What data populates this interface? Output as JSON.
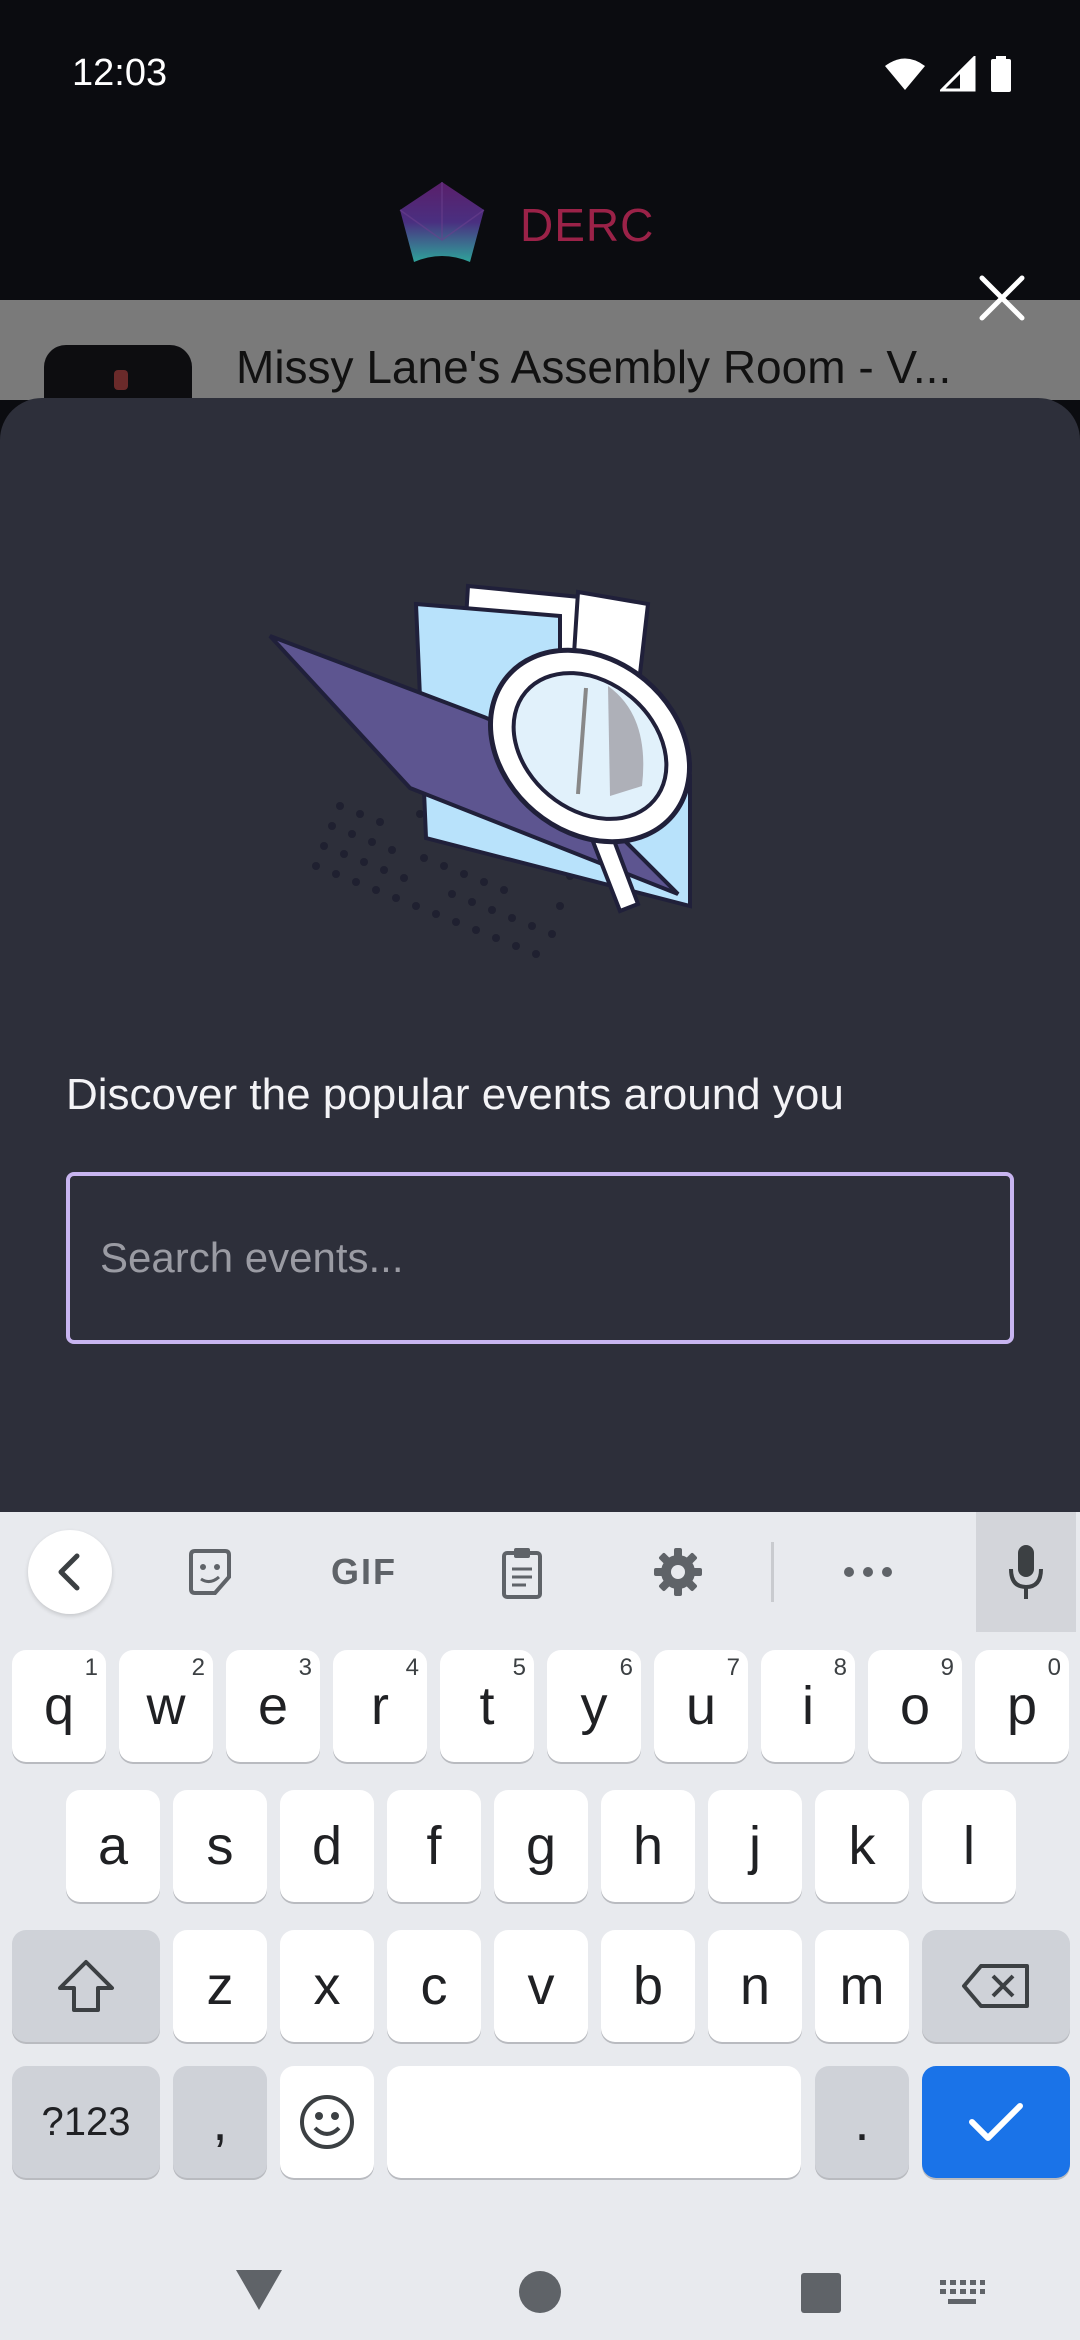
{
  "status_bar": {
    "time": "12:03"
  },
  "app": {
    "brand": "DERC"
  },
  "background": {
    "event_title": "Missy Lane's Assembly Room - V..."
  },
  "sheet": {
    "headline": "Discover the popular events around you",
    "search_placeholder": "Search events..."
  },
  "keyboard": {
    "toolbar": {
      "gif_label": "GIF",
      "icons": [
        "back-chevron-icon",
        "sticker-icon",
        "gif-icon",
        "clipboard-icon",
        "settings-gear-icon",
        "more-dots-icon",
        "microphone-icon"
      ]
    },
    "row1": [
      {
        "k": "q",
        "h": "1"
      },
      {
        "k": "w",
        "h": "2"
      },
      {
        "k": "e",
        "h": "3"
      },
      {
        "k": "r",
        "h": "4"
      },
      {
        "k": "t",
        "h": "5"
      },
      {
        "k": "y",
        "h": "6"
      },
      {
        "k": "u",
        "h": "7"
      },
      {
        "k": "i",
        "h": "8"
      },
      {
        "k": "o",
        "h": "9"
      },
      {
        "k": "p",
        "h": "0"
      }
    ],
    "row2": [
      "a",
      "s",
      "d",
      "f",
      "g",
      "h",
      "j",
      "k",
      "l"
    ],
    "row3": [
      "z",
      "x",
      "c",
      "v",
      "b",
      "n",
      "m"
    ],
    "symbols_label": "?123",
    "comma": ",",
    "period": "."
  },
  "colors": {
    "brand": "#9b2248",
    "sheet_bg": "#2d2f3a",
    "search_border": "#c8b5f0",
    "action_key": "#1a73e8"
  }
}
